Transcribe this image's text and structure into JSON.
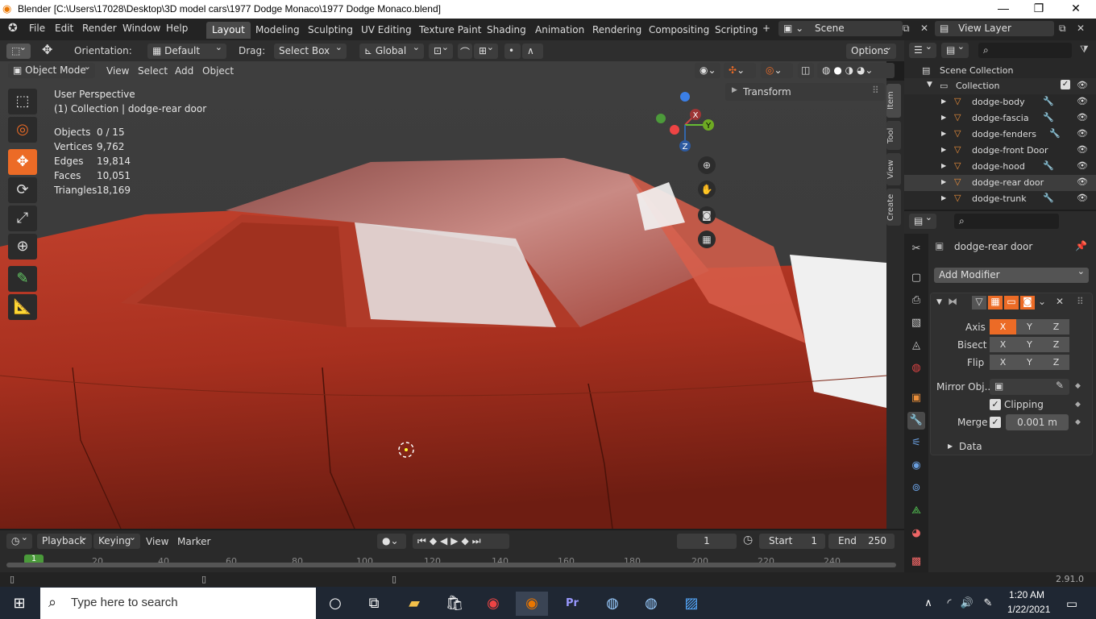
{
  "window": {
    "title": "Blender [C:\\Users\\17028\\Desktop\\3D model cars\\1977 Dodge Monaco\\1977 Dodge Monaco.blend]"
  },
  "menu": [
    "File",
    "Edit",
    "Render",
    "Window",
    "Help"
  ],
  "workspaces": [
    "Layout",
    "Modeling",
    "Sculpting",
    "UV Editing",
    "Texture Paint",
    "Shading",
    "Animation",
    "Rendering",
    "Compositing",
    "Scripting"
  ],
  "scene": {
    "name": "Scene",
    "view_layer": "View Layer"
  },
  "tool_header": {
    "orientation_label": "Orientation:",
    "orientation_value": "Default",
    "drag_label": "Drag:",
    "drag_value": "Select Box",
    "transform_orientation": "Global",
    "options": "Options"
  },
  "viewport_header": {
    "mode": "Object Mode",
    "menus": [
      "View",
      "Select",
      "Add",
      "Object"
    ]
  },
  "viewport_info": {
    "perspective": "User Perspective",
    "collection": "(1) Collection | dodge-rear door",
    "stats": [
      {
        "label": "Objects",
        "value": "0 / 15"
      },
      {
        "label": "Vertices",
        "value": "9,762"
      },
      {
        "label": "Edges",
        "value": "19,814"
      },
      {
        "label": "Faces",
        "value": "10,051"
      },
      {
        "label": "Triangles",
        "value": "18,169"
      }
    ]
  },
  "gizmo": {
    "x": "X",
    "y": "Y",
    "z": "Z"
  },
  "sidebar": {
    "panel": "Transform",
    "tabs": [
      "Item",
      "Tool",
      "View",
      "Create"
    ]
  },
  "outliner": {
    "scene_collection": "Scene Collection",
    "collection": "Collection",
    "items": [
      "dodge-body",
      "dodge-fascia",
      "dodge-fenders",
      "dodge-front Door",
      "dodge-hood",
      "dodge-rear door",
      "dodge-trunk"
    ]
  },
  "properties": {
    "object_name": "dodge-rear door",
    "add_modifier": "Add Modifier",
    "axis_label": "Axis",
    "bisect_label": "Bisect",
    "flip_label": "Flip",
    "xyz": [
      "X",
      "Y",
      "Z"
    ],
    "mirror_object_label": "Mirror Obj...",
    "clipping_label": "Clipping",
    "merge_label": "Merge",
    "merge_value": "0.001 m",
    "data_label": "Data"
  },
  "timeline": {
    "menus": [
      "Playback",
      "Keying",
      "View",
      "Marker"
    ],
    "current_frame": "1",
    "start_label": "Start",
    "start_value": "1",
    "end_label": "End",
    "end_value": "250",
    "ruler": [
      "1",
      "20",
      "40",
      "60",
      "80",
      "100",
      "120",
      "140",
      "160",
      "180",
      "200",
      "220",
      "240"
    ]
  },
  "status": {
    "version": "2.91.0"
  },
  "taskbar": {
    "search_placeholder": "Type here to search",
    "time": "1:20 AM",
    "date": "1/22/2021"
  }
}
